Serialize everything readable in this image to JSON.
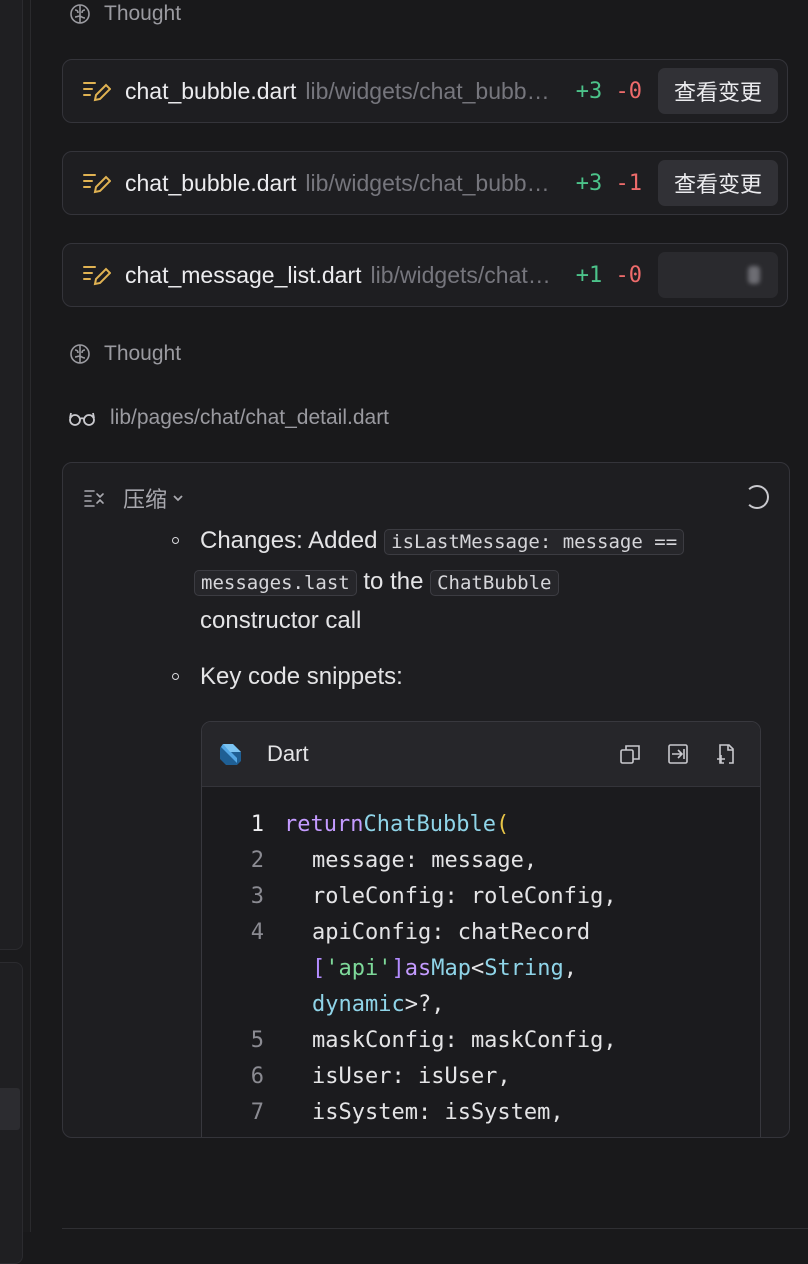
{
  "thought_label": "Thought",
  "file_changes": [
    {
      "name": "chat_bubble.dart",
      "path": "lib/widgets/chat_bubble.dart",
      "add": "+3",
      "del": "-0",
      "button": "查看变更"
    },
    {
      "name": "chat_bubble.dart",
      "path": "lib/widgets/chat_bubble.dart",
      "add": "+3",
      "del": "-1",
      "button": "查看变更"
    },
    {
      "name": "chat_message_list.dart",
      "path": "lib/widgets/chat_message_list.dart",
      "add": "+1",
      "del": "-0",
      "button": ""
    }
  ],
  "read_file": "lib/pages/chat/chat_detail.dart",
  "summary": {
    "header": "压缩",
    "changes_prefix": "Changes: Added",
    "changes_code1a": "isLastMessage: message ==",
    "changes_code1b": "messages.last",
    "changes_mid": "to the",
    "changes_code2": "ChatBubble",
    "changes_suffix": "constructor call",
    "snippets_label": "Key code snippets:"
  },
  "code_block": {
    "language": "Dart",
    "line_numbers": [
      "1",
      "2",
      "3",
      "4",
      "5",
      "6",
      "7"
    ],
    "lines": {
      "l1_kw": "return",
      "l1_ty": "ChatBubble",
      "l1_pu": "(",
      "l2": "message: message,",
      "l3": "roleConfig: roleConfig,",
      "l4a": "apiConfig: chatRecord",
      "l4b_br1": "[",
      "l4b_st": "'api'",
      "l4b_br2": "]",
      "l4b_kw": "as",
      "l4b_ty1": "Map",
      "l4b_lt": "<",
      "l4b_ty2": "String",
      "l4b_c": ",",
      "l4c_ty": "dynamic",
      "l4c_rest": ">?,",
      "l5": "maskConfig: maskConfig,",
      "l6": "isUser: isUser,",
      "l7": "isSystem: isSystem,"
    }
  },
  "colors": {
    "added": "#4cc38a",
    "removed": "#ee6b6b",
    "edit_icon": "#e0b252",
    "dart": "#54a7e5"
  }
}
